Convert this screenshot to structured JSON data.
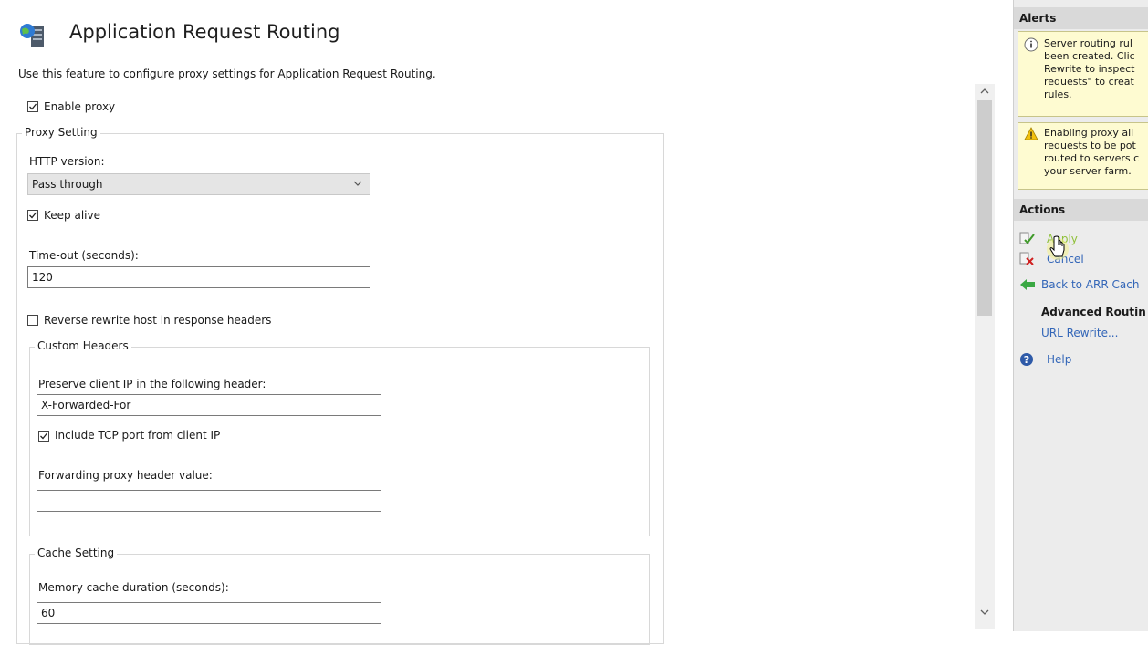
{
  "header": {
    "title": "Application Request Routing",
    "description": "Use this feature to configure proxy settings for Application Request Routing."
  },
  "enable_proxy": {
    "label": "Enable proxy",
    "checked": true
  },
  "proxy_setting": {
    "legend": "Proxy Setting",
    "http_version_label": "HTTP version:",
    "http_version_value": "Pass through",
    "keep_alive": {
      "label": "Keep alive",
      "checked": true
    },
    "timeout_label": "Time-out (seconds):",
    "timeout_value": "120",
    "reverse_rewrite": {
      "label": "Reverse rewrite host in response headers",
      "checked": false
    }
  },
  "custom_headers": {
    "legend": "Custom Headers",
    "preserve_label": "Preserve client IP in the following header:",
    "preserve_value": "X-Forwarded-For",
    "include_tcp": {
      "label": "Include TCP port from client IP",
      "checked": true
    },
    "forwarding_label": "Forwarding proxy header value:",
    "forwarding_value": ""
  },
  "cache_setting": {
    "legend": "Cache Setting",
    "memory_label": "Memory cache duration (seconds):",
    "memory_value": "60"
  },
  "right_panel": {
    "alerts_header": "Alerts",
    "alert1_lines": [
      "Server routing rul",
      "been created. Clic",
      "Rewrite to inspect",
      "requests\" to creat",
      "rules."
    ],
    "alert2_lines": [
      "Enabling proxy all",
      "requests to be pot",
      "routed to servers c",
      "your server farm."
    ],
    "actions_header": "Actions",
    "apply": "Apply",
    "cancel": "Cancel",
    "back": "Back to ARR Cach",
    "advanced": "Advanced Routin",
    "url_rewrite": "URL Rewrite...",
    "help": "Help"
  },
  "icons": {
    "title": "server-globe-icon",
    "info": "info-icon",
    "warning": "warning-icon",
    "apply": "apply-icon",
    "cancel": "cancel-icon",
    "back": "back-arrow-icon",
    "help": "help-icon",
    "cursor": "hand-cursor-icon"
  },
  "colors": {
    "link": "#3366b8",
    "alert_bg": "#fefbd1",
    "panel_header": "#d9d9d9"
  }
}
